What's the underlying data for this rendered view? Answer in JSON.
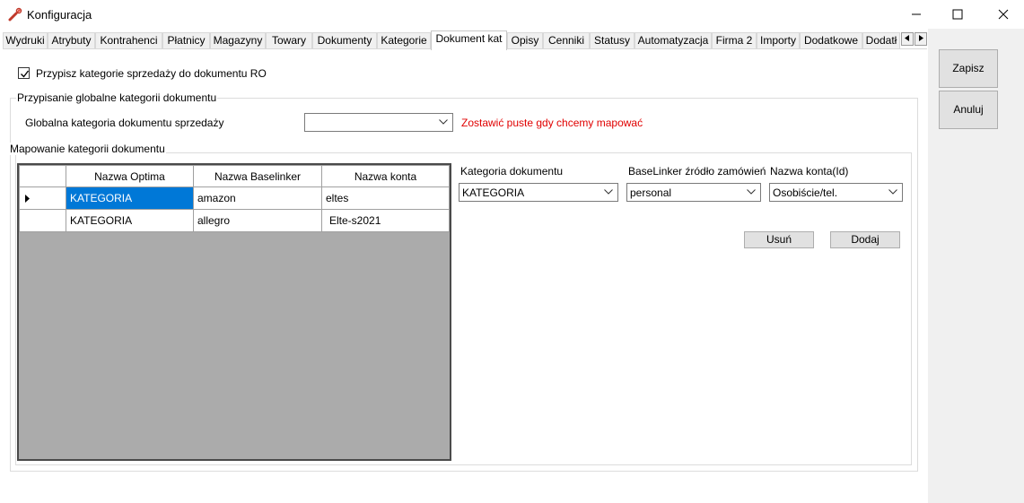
{
  "window": {
    "title": "Konfiguracja"
  },
  "tabs": [
    {
      "label": "Wydruki"
    },
    {
      "label": "Atrybuty"
    },
    {
      "label": "Kontrahenci"
    },
    {
      "label": "Płatnicy"
    },
    {
      "label": "Magazyny"
    },
    {
      "label": "Towary"
    },
    {
      "label": "Dokumenty"
    },
    {
      "label": "Kategorie"
    },
    {
      "label": "Dokument kat"
    },
    {
      "label": "Opisy"
    },
    {
      "label": "Cenniki"
    },
    {
      "label": "Statusy"
    },
    {
      "label": "Automatyzacja"
    },
    {
      "label": "Firma 2"
    },
    {
      "label": "Importy"
    },
    {
      "label": "Dodatkowe"
    },
    {
      "label": "Dodatł"
    }
  ],
  "active_tab": "Dokument kat",
  "side": {
    "save_label": "Zapisz",
    "cancel_label": "Anuluj"
  },
  "assign_checkbox": {
    "label": "Przypisz kategorie sprzedaży do dokumentu RO",
    "checked": true
  },
  "global_group": {
    "title": "Przypisanie globalne kategorii dokumentu",
    "field_label": "Globalna kategoria dokumentu sprzedaży",
    "field_value": "",
    "hint": "Zostawić puste gdy chcemy mapować"
  },
  "mapping_group": {
    "title": "Mapowanie kategorii dokumentu",
    "columns": [
      "Nazwa Optima",
      "Nazwa Baselinker",
      "Nazwa konta"
    ],
    "rows": [
      [
        "KATEGORIA",
        "amazon",
        "eltes"
      ],
      [
        "KATEGORIA",
        "allegro",
        "Elte-s2021"
      ]
    ],
    "kategoria_label": "Kategoria dokumentu",
    "kategoria_value": "KATEGORIA",
    "zrodlo_label": "BaseLinker źródło zamówień",
    "zrodlo_value": "personal",
    "konto_label": "Nazwa konta(Id)",
    "konto_value": "Osobiście/tel.",
    "delete_label": "Usuń",
    "add_label": "Dodaj"
  },
  "colors": {
    "selection": "#0078d7",
    "hint_red": "#e00000",
    "grid_bg": "#ababab"
  }
}
